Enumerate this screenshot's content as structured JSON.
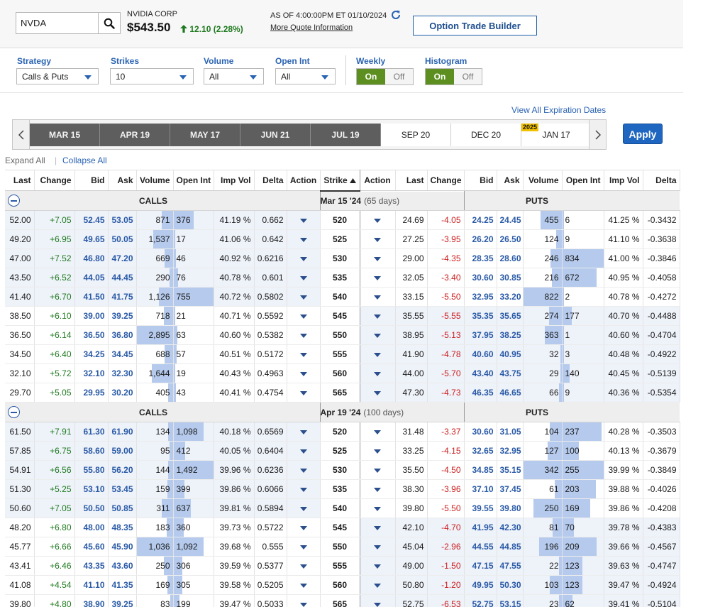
{
  "quote": {
    "symbol": "NVDA",
    "company": "NVIDIA CORP",
    "price": "$543.50",
    "change": "12.10 (2.28%)",
    "as_of": "AS OF 4:00:00PM ET 01/10/2024",
    "more_info": "More Quote Information",
    "option_trade_builder": "Option Trade Builder",
    "icons": {
      "search": "search-icon",
      "refresh": "refresh-icon",
      "up": "arrow-up-icon"
    }
  },
  "filters": {
    "strategy": {
      "label": "Strategy",
      "value": "Calls & Puts"
    },
    "strikes": {
      "label": "Strikes",
      "value": "10"
    },
    "volume": {
      "label": "Volume",
      "value": "All"
    },
    "open_int": {
      "label": "Open Int",
      "value": "All"
    },
    "weekly": {
      "label": "Weekly",
      "on": "On",
      "off": "Off"
    },
    "histogram": {
      "label": "Histogram",
      "on": "On",
      "off": "Off"
    }
  },
  "expirations": {
    "view_all": "View All Expiration Dates",
    "tabs": [
      {
        "label": "MAR 15",
        "selected": true
      },
      {
        "label": "APR 19",
        "selected": true
      },
      {
        "label": "MAY 17",
        "selected": true
      },
      {
        "label": "JUN 21",
        "selected": true
      },
      {
        "label": "JUL 19",
        "selected": true
      },
      {
        "label": "SEP 20",
        "selected": false
      },
      {
        "label": "DEC 20",
        "selected": false
      },
      {
        "label": "JAN 17",
        "selected": false,
        "year": "2025"
      }
    ],
    "apply": "Apply"
  },
  "controls": {
    "expand_all": "Expand All",
    "separator": "|",
    "collapse_all": "Collapse All"
  },
  "columns": {
    "calls": [
      "Last",
      "Change",
      "Bid",
      "Ask",
      "Volume",
      "Open Int",
      "Imp Vol",
      "Delta",
      "Action"
    ],
    "strike": "Strike",
    "puts": [
      "Action",
      "Last",
      "Change",
      "Bid",
      "Ask",
      "Volume",
      "Open Int",
      "Imp Vol",
      "Delta"
    ]
  },
  "sections": [
    {
      "calls_label": "CALLS",
      "date": "Mar 15 '24",
      "days": "(65 days)",
      "puts_label": "PUTS",
      "rows": [
        {
          "strike": "520",
          "c": {
            "last": "52.00",
            "chg": "+7.05",
            "bid": "52.45",
            "ask": "53.05",
            "vol": "871",
            "oi": "376",
            "iv": "41.19 %",
            "delta": "0.662"
          },
          "p": {
            "last": "24.69",
            "chg": "-4.05",
            "bid": "24.25",
            "ask": "24.45",
            "vol": "455",
            "oi": "6",
            "iv": "41.25 %",
            "delta": "-0.3432"
          }
        },
        {
          "strike": "525",
          "c": {
            "last": "49.20",
            "chg": "+6.95",
            "bid": "49.65",
            "ask": "50.05",
            "vol": "1,537",
            "oi": "17",
            "iv": "41.06 %",
            "delta": "0.642"
          },
          "p": {
            "last": "27.25",
            "chg": "-3.95",
            "bid": "26.20",
            "ask": "26.50",
            "vol": "124",
            "oi": "9",
            "iv": "41.10 %",
            "delta": "-0.3638"
          }
        },
        {
          "strike": "530",
          "c": {
            "last": "47.00",
            "chg": "+7.52",
            "bid": "46.80",
            "ask": "47.20",
            "vol": "669",
            "oi": "46",
            "iv": "40.92 %",
            "delta": "0.6216"
          },
          "p": {
            "last": "29.00",
            "chg": "-4.35",
            "bid": "28.35",
            "ask": "28.60",
            "vol": "246",
            "oi": "834",
            "iv": "41.00 %",
            "delta": "-0.3846"
          }
        },
        {
          "strike": "535",
          "c": {
            "last": "43.50",
            "chg": "+6.52",
            "bid": "44.05",
            "ask": "44.45",
            "vol": "290",
            "oi": "76",
            "iv": "40.78 %",
            "delta": "0.601"
          },
          "p": {
            "last": "32.05",
            "chg": "-3.40",
            "bid": "30.60",
            "ask": "30.85",
            "vol": "216",
            "oi": "672",
            "iv": "40.95 %",
            "delta": "-0.4058"
          }
        },
        {
          "strike": "540",
          "c": {
            "last": "41.40",
            "chg": "+6.70",
            "bid": "41.50",
            "ask": "41.75",
            "vol": "1,126",
            "oi": "755",
            "iv": "40.72 %",
            "delta": "0.5802"
          },
          "p": {
            "last": "33.15",
            "chg": "-5.50",
            "bid": "32.95",
            "ask": "33.20",
            "vol": "822",
            "oi": "2",
            "iv": "40.78 %",
            "delta": "-0.4272"
          }
        },
        {
          "strike": "545",
          "c": {
            "last": "38.50",
            "chg": "+6.10",
            "bid": "39.00",
            "ask": "39.25",
            "vol": "718",
            "oi": "21",
            "iv": "40.71 %",
            "delta": "0.5592"
          },
          "p": {
            "last": "35.55",
            "chg": "-5.55",
            "bid": "35.35",
            "ask": "35.65",
            "vol": "274",
            "oi": "177",
            "iv": "40.70 %",
            "delta": "-0.4488"
          }
        },
        {
          "strike": "550",
          "c": {
            "last": "36.50",
            "chg": "+6.14",
            "bid": "36.50",
            "ask": "36.80",
            "vol": "2,895",
            "oi": "63",
            "iv": "40.60 %",
            "delta": "0.5382"
          },
          "p": {
            "last": "38.95",
            "chg": "-5.13",
            "bid": "37.95",
            "ask": "38.25",
            "vol": "363",
            "oi": "1",
            "iv": "40.60 %",
            "delta": "-0.4704"
          }
        },
        {
          "strike": "555",
          "c": {
            "last": "34.50",
            "chg": "+6.40",
            "bid": "34.25",
            "ask": "34.45",
            "vol": "688",
            "oi": "57",
            "iv": "40.51 %",
            "delta": "0.5172"
          },
          "p": {
            "last": "41.90",
            "chg": "-4.78",
            "bid": "40.60",
            "ask": "40.95",
            "vol": "32",
            "oi": "3",
            "iv": "40.48 %",
            "delta": "-0.4922"
          }
        },
        {
          "strike": "560",
          "c": {
            "last": "32.10",
            "chg": "+5.72",
            "bid": "32.10",
            "ask": "32.30",
            "vol": "1,644",
            "oi": "19",
            "iv": "40.43 %",
            "delta": "0.4963"
          },
          "p": {
            "last": "44.00",
            "chg": "-5.70",
            "bid": "43.40",
            "ask": "43.75",
            "vol": "29",
            "oi": "140",
            "iv": "40.45 %",
            "delta": "-0.5139"
          }
        },
        {
          "strike": "565",
          "c": {
            "last": "29.70",
            "chg": "+5.05",
            "bid": "29.95",
            "ask": "30.20",
            "vol": "405",
            "oi": "43",
            "iv": "40.41 %",
            "delta": "0.4754"
          },
          "p": {
            "last": "47.30",
            "chg": "-4.73",
            "bid": "46.35",
            "ask": "46.65",
            "vol": "66",
            "oi": "9",
            "iv": "40.36 %",
            "delta": "-0.5354"
          }
        }
      ]
    },
    {
      "calls_label": "CALLS",
      "date": "Apr 19 '24",
      "days": "(100 days)",
      "puts_label": "PUTS",
      "rows": [
        {
          "strike": "520",
          "c": {
            "last": "61.50",
            "chg": "+7.91",
            "bid": "61.30",
            "ask": "61.90",
            "vol": "134",
            "oi": "1,098",
            "iv": "40.18 %",
            "delta": "0.6569"
          },
          "p": {
            "last": "31.48",
            "chg": "-3.37",
            "bid": "30.60",
            "ask": "31.05",
            "vol": "104",
            "oi": "237",
            "iv": "40.28 %",
            "delta": "-0.3503"
          }
        },
        {
          "strike": "525",
          "c": {
            "last": "57.85",
            "chg": "+6.75",
            "bid": "58.60",
            "ask": "59.00",
            "vol": "95",
            "oi": "412",
            "iv": "40.05 %",
            "delta": "0.6404"
          },
          "p": {
            "last": "33.25",
            "chg": "-4.15",
            "bid": "32.65",
            "ask": "32.95",
            "vol": "127",
            "oi": "100",
            "iv": "40.13 %",
            "delta": "-0.3679"
          }
        },
        {
          "strike": "530",
          "c": {
            "last": "54.91",
            "chg": "+6.56",
            "bid": "55.80",
            "ask": "56.20",
            "vol": "144",
            "oi": "1,492",
            "iv": "39.96 %",
            "delta": "0.6236"
          },
          "p": {
            "last": "35.50",
            "chg": "-4.50",
            "bid": "34.85",
            "ask": "35.15",
            "vol": "342",
            "oi": "255",
            "iv": "39.99 %",
            "delta": "-0.3849"
          }
        },
        {
          "strike": "535",
          "c": {
            "last": "51.30",
            "chg": "+5.25",
            "bid": "53.10",
            "ask": "53.45",
            "vol": "159",
            "oi": "399",
            "iv": "39.86 %",
            "delta": "0.6066"
          },
          "p": {
            "last": "38.30",
            "chg": "-3.96",
            "bid": "37.10",
            "ask": "37.45",
            "vol": "61",
            "oi": "203",
            "iv": "39.88 %",
            "delta": "-0.4026"
          }
        },
        {
          "strike": "540",
          "c": {
            "last": "50.60",
            "chg": "+7.05",
            "bid": "50.50",
            "ask": "50.85",
            "vol": "311",
            "oi": "637",
            "iv": "39.81 %",
            "delta": "0.5894"
          },
          "p": {
            "last": "39.80",
            "chg": "-5.50",
            "bid": "39.55",
            "ask": "39.80",
            "vol": "250",
            "oi": "169",
            "iv": "39.86 %",
            "delta": "-0.4208"
          }
        },
        {
          "strike": "545",
          "c": {
            "last": "48.20",
            "chg": "+6.80",
            "bid": "48.00",
            "ask": "48.35",
            "vol": "183",
            "oi": "360",
            "iv": "39.73 %",
            "delta": "0.5722"
          },
          "p": {
            "last": "42.10",
            "chg": "-4.70",
            "bid": "41.95",
            "ask": "42.30",
            "vol": "81",
            "oi": "70",
            "iv": "39.78 %",
            "delta": "-0.4383"
          }
        },
        {
          "strike": "550",
          "c": {
            "last": "45.77",
            "chg": "+6.66",
            "bid": "45.60",
            "ask": "45.90",
            "vol": "1,036",
            "oi": "1,092",
            "iv": "39.68 %",
            "delta": "0.555"
          },
          "p": {
            "last": "45.04",
            "chg": "-2.96",
            "bid": "44.55",
            "ask": "44.85",
            "vol": "196",
            "oi": "209",
            "iv": "39.66 %",
            "delta": "-0.4567"
          }
        },
        {
          "strike": "555",
          "c": {
            "last": "43.41",
            "chg": "+6.46",
            "bid": "43.35",
            "ask": "43.60",
            "vol": "250",
            "oi": "306",
            "iv": "39.59 %",
            "delta": "0.5377"
          },
          "p": {
            "last": "49.00",
            "chg": "-1.50",
            "bid": "47.15",
            "ask": "47.55",
            "vol": "22",
            "oi": "123",
            "iv": "39.63 %",
            "delta": "-0.4747"
          }
        },
        {
          "strike": "560",
          "c": {
            "last": "41.08",
            "chg": "+4.54",
            "bid": "41.10",
            "ask": "41.35",
            "vol": "169",
            "oi": "305",
            "iv": "39.58 %",
            "delta": "0.5205"
          },
          "p": {
            "last": "50.80",
            "chg": "-1.20",
            "bid": "49.95",
            "ask": "50.30",
            "vol": "103",
            "oi": "123",
            "iv": "39.47 %",
            "delta": "-0.4924"
          }
        },
        {
          "strike": "565",
          "c": {
            "last": "39.80",
            "chg": "+4.80",
            "bid": "38.90",
            "ask": "39.25",
            "vol": "83",
            "oi": "199",
            "iv": "39.47 %",
            "delta": "0.5033"
          },
          "p": {
            "last": "52.75",
            "chg": "-6.53",
            "bid": "52.75",
            "ask": "53.15",
            "vol": "23",
            "oi": "62",
            "iv": "39.41 %",
            "delta": "-0.5104"
          }
        }
      ]
    }
  ],
  "colors": {
    "positive": "#1f7a1f",
    "negative": "#cc1f1f",
    "link": "#2a63b3",
    "histogram_bar": "#b5caed",
    "toggle_on": "#5c8f1f",
    "apply": "#1f66c1"
  }
}
